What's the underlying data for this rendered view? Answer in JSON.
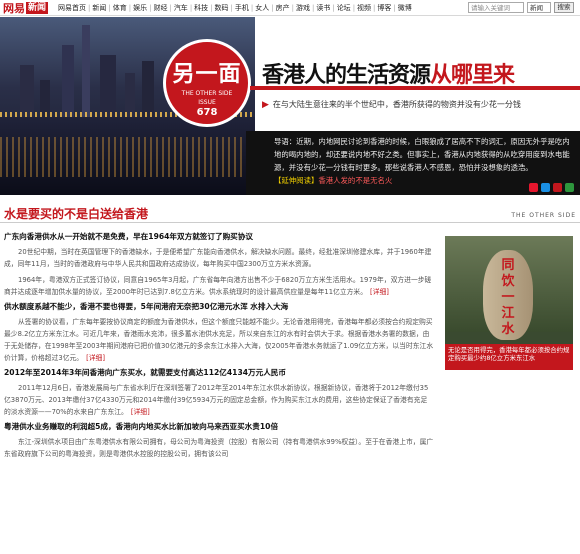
{
  "topbar": {
    "logo_main": "网易",
    "logo_news": "新闻",
    "nav": [
      "网易首页",
      "新闻",
      "体育",
      "娱乐",
      "财经",
      "汽车",
      "科技",
      "数码",
      "手机",
      "女人",
      "房产",
      "游戏",
      "读书",
      "论坛",
      "视频",
      "博客",
      "微博"
    ],
    "search_placeholder": "请输入关键词",
    "search_scope": "新闻",
    "search_button": "搜索"
  },
  "hero": {
    "badge_title": "另一面",
    "badge_sub": "THE OTHER SIDE",
    "badge_issue_label": "ISSUE",
    "badge_issue": "678",
    "title_black": "香港人的生活资源",
    "title_red": "从哪里来",
    "subtitle": "在与大陆生意往来的半个世纪中，香港所获得的物资并没有少花一分钱",
    "intro": "导语：近期，内地网民讨论到香港的时候，白眼狼成了居高不下的词汇，原因无外乎是吃内地的喝内地的，却还要说内地不好之类。但事实上，香港从内地获得的从吃穿用度到水电能源，并没有少花一分钱有时更多。那些说香港人不感恩，恐怕并没想象的透浩。",
    "intro_more": "【延伸阅读】",
    "intro_link": "香港人发的不是无名火"
  },
  "section": {
    "title": "水是要买的不是白送给香港",
    "side_label": "THE OTHER SIDE"
  },
  "articles": [
    {
      "heading": "广东向香港供水从一开始就不是免费，早在1964年双方就签订了购买协议",
      "paras": [
        "20世纪中期，当时在英国管理下的香港缺水，于是便希望广东能向香港供水，解决缺水问题。最终，经批准深圳修建水库，并于1960年建成，同年11月，当时的香港政府与中华人民共和国政府达成协议，每年购买中国2300万立方米水资源。",
        "1964年，粤港双方正式签订协议，同意自1965年3月起，广东省每年向港方出售不少于6820万立方米生活用水。1979年，双方进一步磋商并达成逐年增加供水量的协议，至2000年时已达到7.8亿立方米。供水系统现时的设计最高供应量是每年11亿立方米。"
      ],
      "detail": "[详细]"
    },
    {
      "heading": "供水额度系越不能少，香港不要也得要，5年间港府无奈把30亿港元水浑 水排入大海",
      "paras": [
        "从签署的协议看，广东每年要按协议商定的额度为香港供水，但这个额度只能越不能少。无论香港用得完，香港每年都必须按合约规定购买最少8.2亿立方米东江水。可近几年来，香港雨水充沛，很多蓄水池供水充足，所以来自东江的水有时会供大于求。根据香港水务署的数据，由于无处储存，在1998年至2003年期间港府已把价值30亿港元的多余东江水排入大海，仅2005年香港水务就运了1.09亿立方米，以当时东江水价计算，价格超过3亿元。"
      ],
      "detail": "[详细]"
    },
    {
      "heading": "2012年至2014年3年间香港向广东买水，就需要支付高达112亿4134万元人民币",
      "paras": [
        "2011年12月6日，香港发展局与广东省水利厅在深圳签署了2012年至2014年东江水供水新协议，根据新协议，香港将于2012年缴付35亿3870万元、2013年缴付37亿4330万元和2014年缴付39亿5934万元的固定总金额，作为购买东江水的费用，这些协定保证了香港有充足的淡水资源——70%的水来自广东东江。"
      ],
      "detail": "[详细]"
    },
    {
      "heading": "粤港供水业务赚取的利润超5成，香港向内地买水比新加坡向马来西亚买水贵10倍",
      "paras": [
        "东江-深圳供水项目由广东粤港供水有限公司拥有，母公司为粤海投资（控股）有限公司（持有粤港供水99%权益）。至于在香港上市，属广东省政府旗下公司的粤海投资，则是粤港供水控股的控股公司，拥有该公司"
      ],
      "detail": ""
    }
  ],
  "side": {
    "rock_text": "同饮一江水",
    "caption": "无论是否用得完，香港每年都必须按合约规定购买最少约8亿立方米东江水"
  },
  "colors": {
    "brand_red": "#c3171d",
    "intro_bg": "#111111"
  }
}
